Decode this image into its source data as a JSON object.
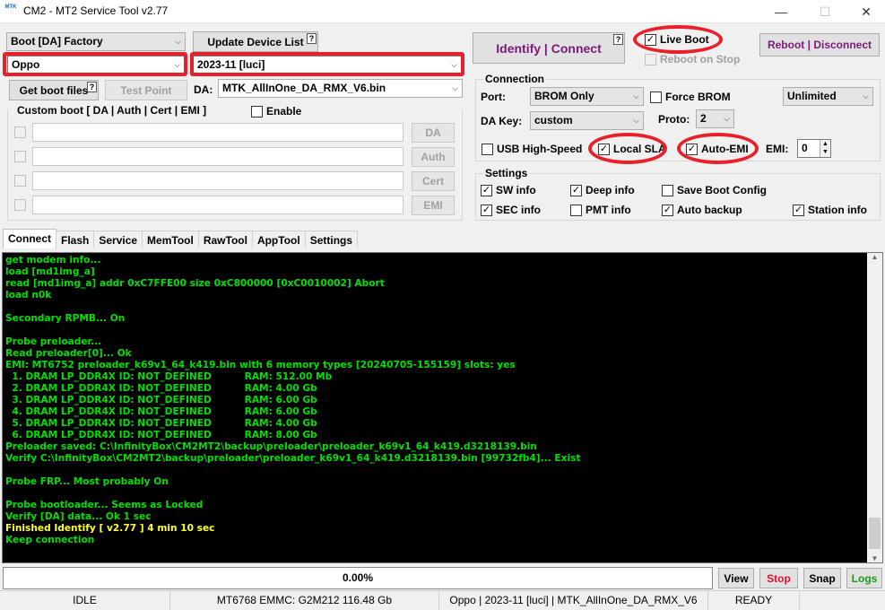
{
  "window": {
    "title": "CM2 - MT2 Service Tool v2.77",
    "logo_text": "MTK",
    "minimize": "—",
    "maximize": "☐",
    "close": "✕"
  },
  "left": {
    "boot_mode": "Boot [DA] Factory",
    "update_device_list": "Update Device List",
    "help": "?",
    "brand": "Oppo",
    "model": "2023-11 [luci]",
    "get_boot_files": "Get boot files",
    "test_point": "Test Point",
    "da_label": "DA:",
    "da_file": "MTK_AllInOne_DA_RMX_V6.bin",
    "custom_boot_label": "Custom boot [ DA | Auth | Cert | EMI ]",
    "enable": "Enable",
    "custom_buttons": [
      "DA",
      "Auth",
      "Cert",
      "EMI"
    ]
  },
  "right": {
    "identify_connect": "Identify | Connect",
    "live_boot": "Live Boot",
    "reboot_on_stop": "Reboot on Stop",
    "reboot_disconnect": "Reboot | Disconnect",
    "connection": {
      "title": "Connection",
      "port_label": "Port:",
      "port_value": "BROM Only",
      "force_brom": "Force BROM",
      "speed_value": "Unlimited",
      "da_key_label": "DA Key:",
      "da_key_value": "custom",
      "proto_label": "Proto:",
      "proto_value": "2",
      "usb_high_speed": "USB High-Speed",
      "local_sla": "Local SLA",
      "auto_emi": "Auto-EMI",
      "emi_label": "EMI:",
      "emi_value": "0"
    },
    "settings": {
      "title": "Settings",
      "sw_info": "SW info",
      "deep_info": "Deep info",
      "save_boot_config": "Save Boot Config",
      "sec_info": "SEC info",
      "pmt_info": "PMT info",
      "auto_backup": "Auto backup",
      "station_info": "Station info"
    }
  },
  "tabs": [
    "Connect",
    "Flash",
    "Service",
    "MemTool",
    "RawTool",
    "AppTool",
    "Settings"
  ],
  "log": [
    {
      "t": "get modem info...",
      "c": "g"
    },
    {
      "t": "load [md1img_a]",
      "c": "g"
    },
    {
      "t": "read [md1img_a] addr 0xC7FFE00 size 0xC800000 [0xC0010002] Abort",
      "c": "g"
    },
    {
      "t": "load n0k",
      "c": "g"
    },
    {
      "t": "",
      "c": "g"
    },
    {
      "t": "Secondary RPMB... On",
      "c": "g"
    },
    {
      "t": "",
      "c": "g"
    },
    {
      "t": "Probe preloader...",
      "c": "g"
    },
    {
      "t": "Read preloader[0]... Ok",
      "c": "g"
    },
    {
      "t": "EMI: MT6752 preloader_k69v1_64_k419.bin with 6 memory types [20240705-155159] slots: yes",
      "c": "g"
    },
    {
      "t": "  1. DRAM LP_DDR4X ID: NOT_DEFINED          RAM: 512.00 Mb",
      "c": "g"
    },
    {
      "t": "  2. DRAM LP_DDR4X ID: NOT_DEFINED          RAM: 4.00 Gb",
      "c": "g"
    },
    {
      "t": "  3. DRAM LP_DDR4X ID: NOT_DEFINED          RAM: 6.00 Gb",
      "c": "g"
    },
    {
      "t": "  4. DRAM LP_DDR4X ID: NOT_DEFINED          RAM: 6.00 Gb",
      "c": "g"
    },
    {
      "t": "  5. DRAM LP_DDR4X ID: NOT_DEFINED          RAM: 4.00 Gb",
      "c": "g"
    },
    {
      "t": "  6. DRAM LP_DDR4X ID: NOT_DEFINED          RAM: 8.00 Gb",
      "c": "g"
    },
    {
      "t": "Preloader saved: C:\\InfinityBox\\CM2MT2\\backup\\preloader\\preloader_k69v1_64_k419.d3218139.bin",
      "c": "g"
    },
    {
      "t": "Verify C:\\InfinityBox\\CM2MT2\\backup\\preloader\\preloader_k69v1_64_k419.d3218139.bin [99732fb4]... Exist",
      "c": "g"
    },
    {
      "t": "",
      "c": "g"
    },
    {
      "t": "Probe FRP... Most probably On",
      "c": "g"
    },
    {
      "t": "",
      "c": "g"
    },
    {
      "t": "Probe bootloader... Seems as Locked",
      "c": "g"
    },
    {
      "t": "Verify [DA] data... Ok 1 sec",
      "c": "g"
    },
    {
      "t": "Finished Identify [ v2.77 ] 4 min 10 sec",
      "c": "y"
    },
    {
      "t": "Keep connection",
      "c": "g"
    }
  ],
  "log_colors": {
    "g": "#00e000",
    "y": "#ffff33"
  },
  "bottom": {
    "progress": "0.00%",
    "view": "View",
    "stop": "Stop",
    "snap": "Snap",
    "logs": "Logs"
  },
  "status": {
    "state": "IDLE",
    "chip": "MT6768 EMMC: G2M212 116.48 Gb",
    "device": "Oppo | 2023-11 [luci] | MTK_AllInOne_DA_RMX_V6",
    "ready": "READY"
  }
}
